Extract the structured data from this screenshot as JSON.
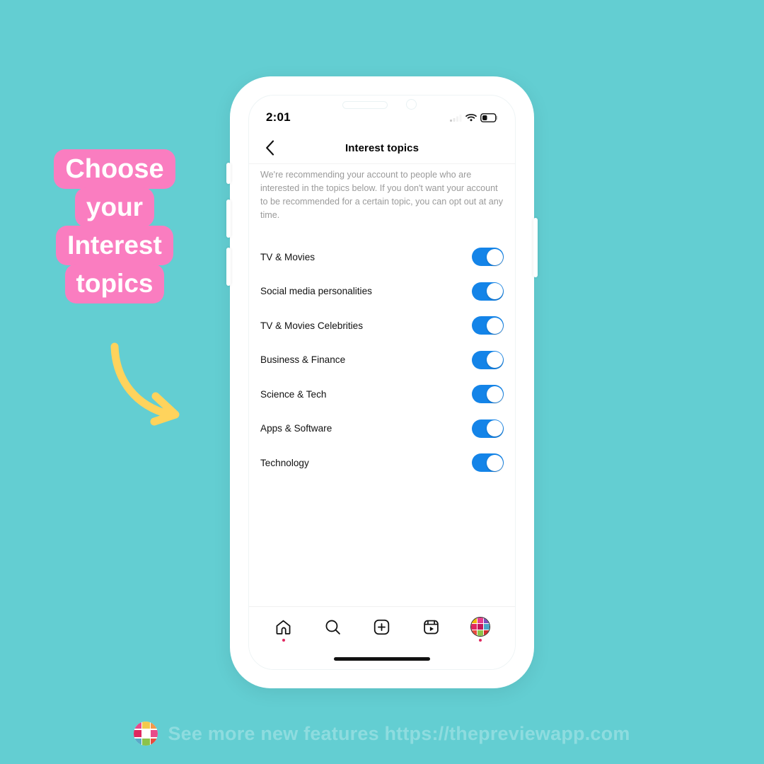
{
  "theme": {
    "background": "#63ced2",
    "pink": "#fa7dc0",
    "yellow": "#ffd35c",
    "toggle_on": "#1484e8",
    "footer_text_color": "#8edcdf"
  },
  "headline": {
    "lines": [
      "Choose",
      "your",
      "Interest",
      "topics"
    ]
  },
  "arrow": {
    "icon": "curved-arrow-icon"
  },
  "phone": {
    "status_bar": {
      "time": "2:01",
      "icons": [
        "cellular-signal-icon",
        "wifi-icon",
        "battery-icon"
      ]
    },
    "nav": {
      "back_icon": "chevron-left-icon",
      "title": "Interest topics"
    },
    "description": "We're recommending your account to people who are interested in the topics below. If you don't want your account to be recommended for a certain topic, you can opt out at any time.",
    "topics": [
      {
        "label": "TV & Movies",
        "enabled": true
      },
      {
        "label": "Social media personalities",
        "enabled": true
      },
      {
        "label": "TV & Movies Celebrities",
        "enabled": true
      },
      {
        "label": "Business & Finance",
        "enabled": true
      },
      {
        "label": "Science & Tech",
        "enabled": true
      },
      {
        "label": "Apps & Software",
        "enabled": true
      },
      {
        "label": "Technology",
        "enabled": true
      }
    ],
    "tabs": [
      {
        "name": "home-icon",
        "badge": true
      },
      {
        "name": "search-icon",
        "badge": false
      },
      {
        "name": "create-post-icon",
        "badge": false
      },
      {
        "name": "reels-icon",
        "badge": false
      },
      {
        "name": "profile-avatar",
        "badge": true
      }
    ]
  },
  "footer": {
    "logo": "preview-app-logo",
    "text": "See more new features https://thepreviewapp.com"
  },
  "avatar_colors": [
    "#f2b705",
    "#e83e8c",
    "#7c4dbe",
    "#e0275f",
    "#c2185b",
    "#4aa3c7",
    "#e84a3e",
    "#8bc34a",
    "#d32f2f"
  ],
  "footer_logo_colors": [
    "#e84a8a",
    "#f2c94c",
    "#f2994a",
    "#e0275f",
    "#ffffff",
    "#e84a8a",
    "#5aa9c9",
    "#8bc34a",
    "#e84a3e"
  ]
}
